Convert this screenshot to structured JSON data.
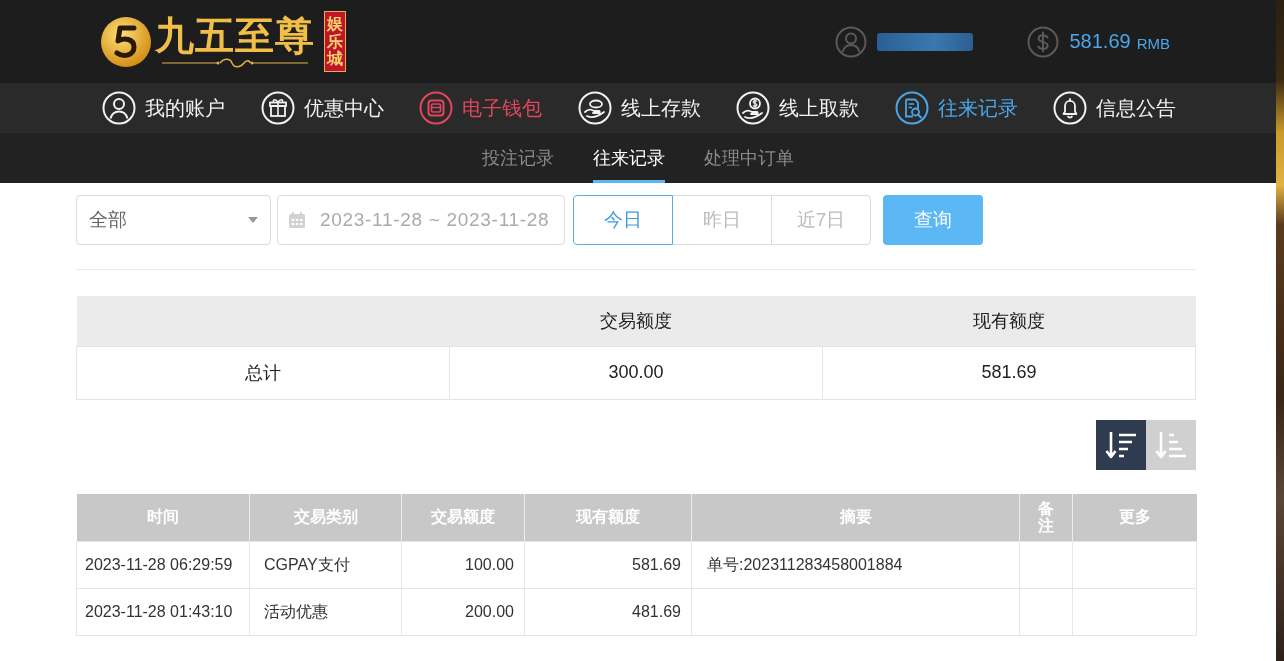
{
  "header": {
    "logo": {
      "name": "九五至尊",
      "tag": "娱乐城"
    },
    "account": {
      "balance": "581.69",
      "currency": "RMB"
    }
  },
  "nav": {
    "items": [
      {
        "label": "我的账户",
        "selected": false,
        "highlighted": false
      },
      {
        "label": "优惠中心",
        "selected": false,
        "highlighted": false
      },
      {
        "label": "电子钱包",
        "selected": false,
        "highlighted": true
      },
      {
        "label": "线上存款",
        "selected": false,
        "highlighted": false
      },
      {
        "label": "线上取款",
        "selected": false,
        "highlighted": false
      },
      {
        "label": "往来记录",
        "selected": true,
        "highlighted": false
      },
      {
        "label": "信息公告",
        "selected": false,
        "highlighted": false
      }
    ]
  },
  "subtabs": [
    {
      "label": "投注记录",
      "selected": false
    },
    {
      "label": "往来记录",
      "selected": true
    },
    {
      "label": "处理中订单",
      "selected": false
    }
  ],
  "filters": {
    "type_select": {
      "value": "全部"
    },
    "date_range": {
      "value": "2023-11-28 ~ 2023-11-28"
    },
    "quick_ranges": [
      {
        "label": "今日",
        "selected": true
      },
      {
        "label": "昨日",
        "selected": false
      },
      {
        "label": "近7日",
        "selected": false
      }
    ],
    "query_button": "查询"
  },
  "summary_table": {
    "columns": [
      "交易额度",
      "现有额度"
    ],
    "rows": [
      {
        "label": "总计",
        "values": [
          "300.00",
          "581.69"
        ]
      }
    ]
  },
  "sort_buttons": [
    {
      "selected": true
    },
    {
      "selected": false
    }
  ],
  "table": {
    "columns": [
      "时间",
      "交易类别",
      "交易额度",
      "现有额度",
      "摘要",
      "备注",
      "更多"
    ],
    "rows": [
      {
        "time": "2023-11-28 06:29:59",
        "category": "CGPAY支付",
        "amount": "100.00",
        "balance": "581.69",
        "summary": "单号:202311283458001884"
      },
      {
        "time": "2023-11-28 01:43:10",
        "category": "活动优惠",
        "amount": "200.00",
        "balance": "481.69"
      }
    ]
  }
}
